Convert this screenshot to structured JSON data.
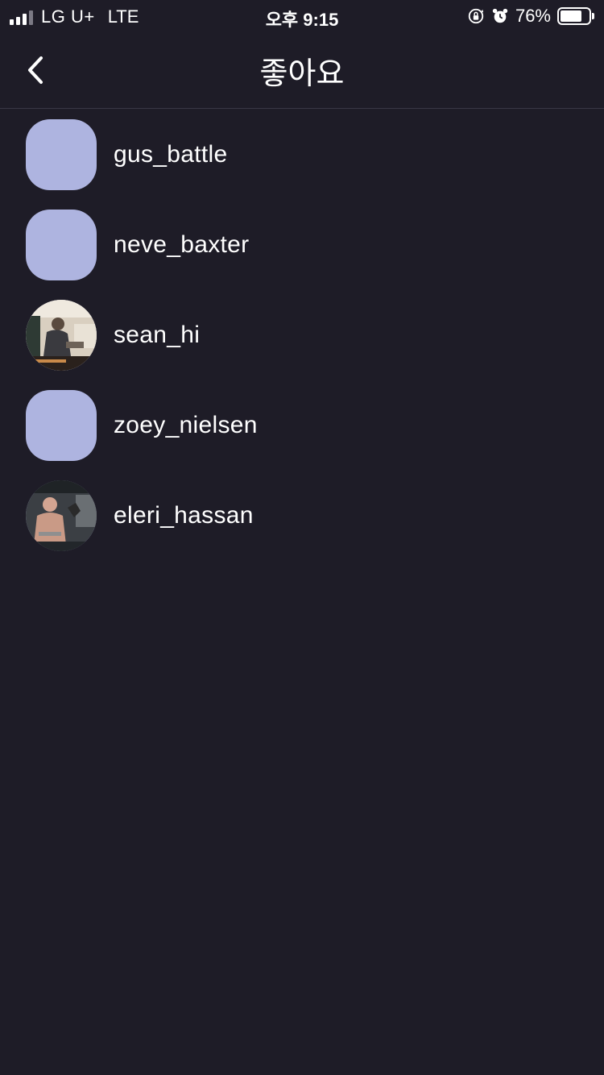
{
  "status_bar": {
    "carrier": "LG U+",
    "network": "LTE",
    "time": "오후 9:15",
    "battery": "76%",
    "battery_level": 0.76,
    "icons": [
      "signal-icon",
      "rotation-lock-icon",
      "alarm-icon",
      "battery-icon"
    ]
  },
  "nav": {
    "title": "좋아요",
    "back_icon": "chevron-left-icon"
  },
  "likes": [
    {
      "username": "gus_battle",
      "avatar": "placeholder",
      "avatar_color": "#aeb4e0"
    },
    {
      "username": "neve_baxter",
      "avatar": "placeholder",
      "avatar_color": "#aeb4e0"
    },
    {
      "username": "sean_hi",
      "avatar": "photo"
    },
    {
      "username": "zoey_nielsen",
      "avatar": "placeholder",
      "avatar_color": "#aeb4e0"
    },
    {
      "username": "eleri_hassan",
      "avatar": "photo"
    }
  ],
  "colors": {
    "background": "#1e1c27",
    "divider": "#3a3845",
    "text": "#ffffff",
    "avatar_placeholder": "#aeb4e0"
  }
}
